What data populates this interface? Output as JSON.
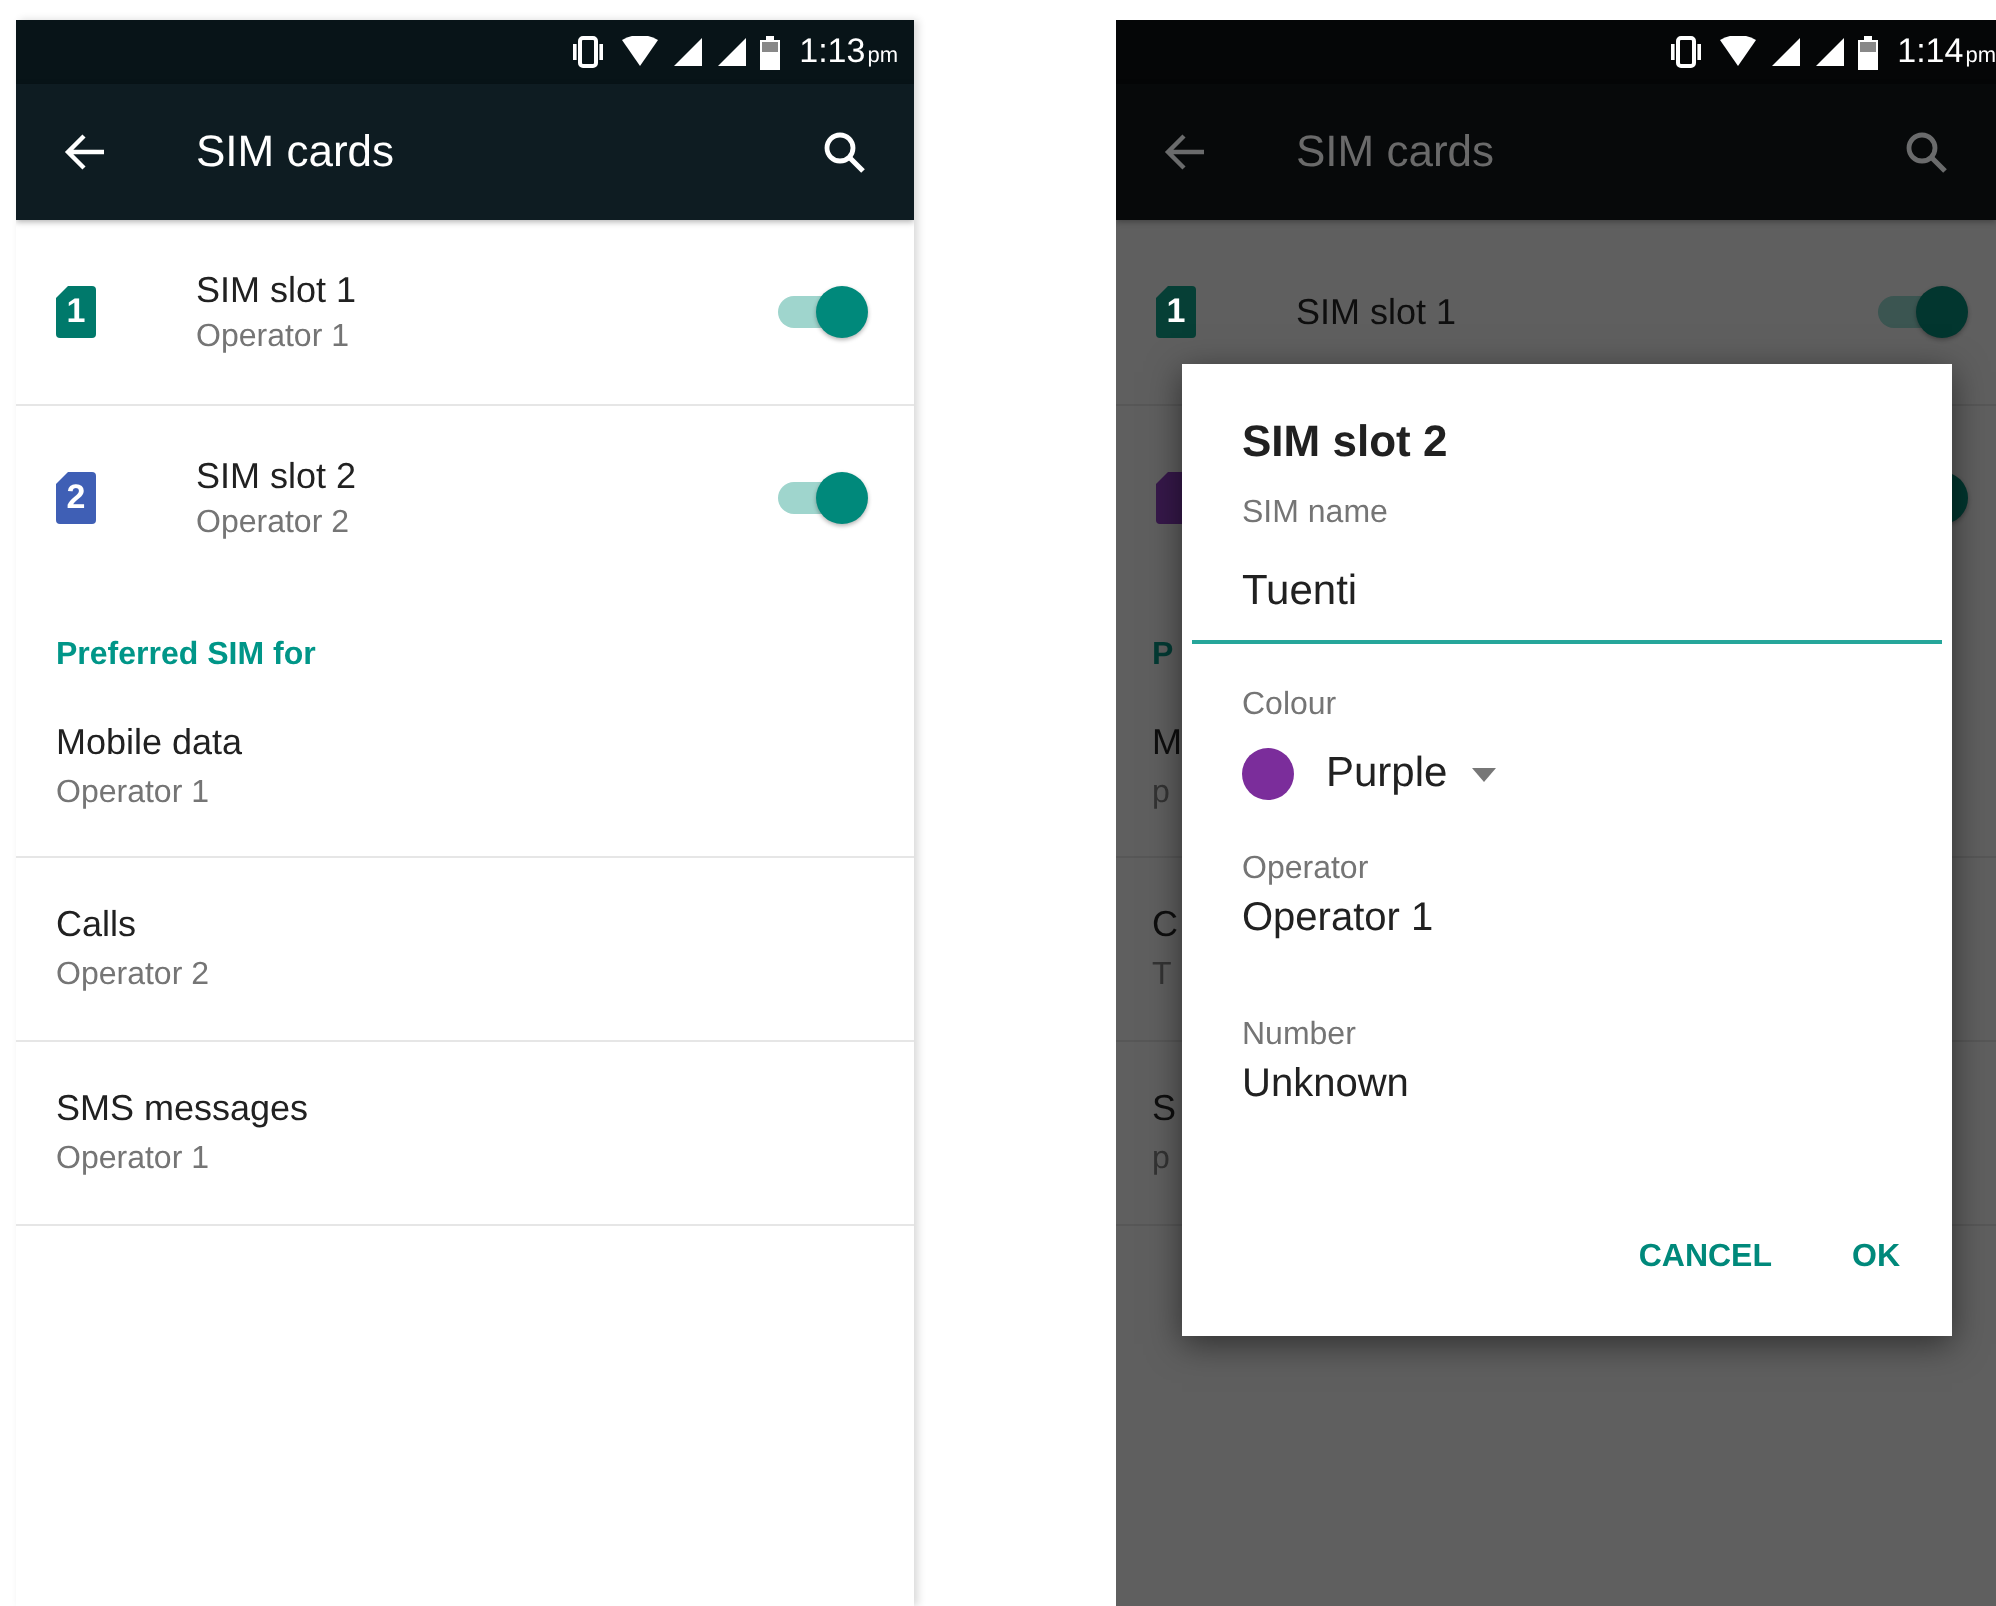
{
  "screens": [
    {
      "status_bar": {
        "time": "1:13",
        "meridiem": "pm"
      },
      "toolbar": {
        "title": "SIM cards"
      },
      "sim_slots": [
        {
          "name": "SIM slot 1",
          "operator": "Operator 1",
          "number": "1",
          "color": "#00796b",
          "on": true
        },
        {
          "name": "SIM slot 2",
          "operator": "Operator 2",
          "number": "2",
          "color": "#3f5fb5",
          "on": true
        }
      ],
      "section_header": "Preferred SIM for",
      "preferences": [
        {
          "label": "Mobile data",
          "value": "Operator 1"
        },
        {
          "label": "Calls",
          "value": "Operator 2"
        },
        {
          "label": "SMS messages",
          "value": "Operator 1"
        }
      ]
    },
    {
      "status_bar": {
        "time": "1:14",
        "meridiem": "pm"
      },
      "toolbar": {
        "title": "SIM cards"
      },
      "sim_slots": [
        {
          "name": "SIM slot 1",
          "number": "1",
          "color": "#063f36",
          "on": true
        },
        {
          "color": "#36184a",
          "on": true
        }
      ],
      "section_header": "P",
      "preferences": [
        {
          "label": "M",
          "value": "p"
        },
        {
          "label": "C",
          "value": "T"
        },
        {
          "label": "S",
          "value": "p"
        }
      ],
      "dialog": {
        "title": "SIM slot 2",
        "fields": [
          {
            "kind": "input",
            "label": "SIM name",
            "value": "Tuenti"
          },
          {
            "kind": "color",
            "label": "Colour",
            "value": "Purple",
            "color": "#7b2d9b"
          },
          {
            "kind": "text",
            "label": "Operator",
            "value": "Operator 1"
          },
          {
            "kind": "text",
            "label": "Number",
            "value": "Unknown"
          }
        ],
        "buttons": [
          "CANCEL",
          "OK"
        ]
      }
    }
  ]
}
